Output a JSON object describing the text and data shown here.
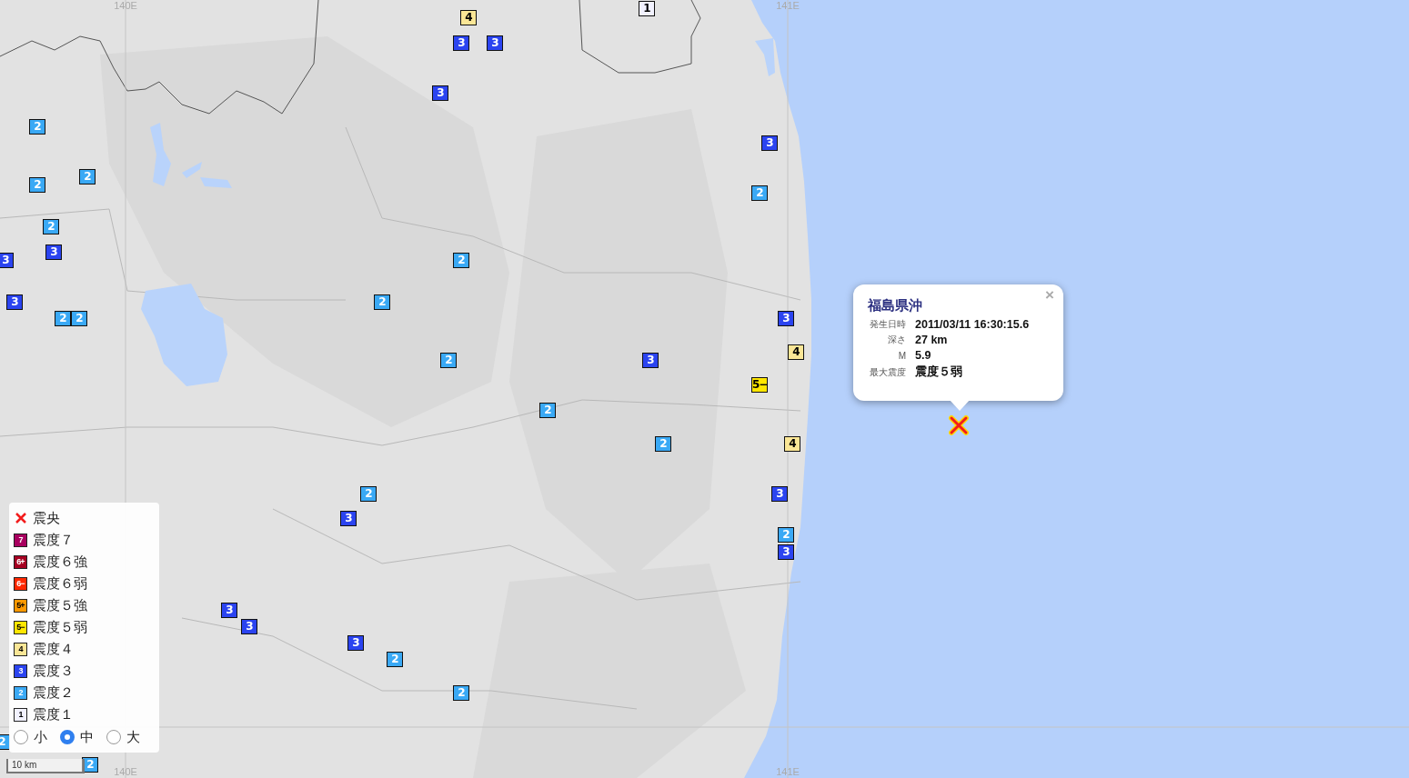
{
  "grid_labels": [
    "140E",
    "140E",
    "141E",
    "141E"
  ],
  "markers": [
    {
      "label": "1",
      "color": "#f2f2ff"
    },
    {
      "label": "4",
      "color": "#fae696"
    },
    {
      "label": "3",
      "color": "#2b44f0"
    },
    {
      "label": "3",
      "color": "#2b44f0"
    },
    {
      "label": "3",
      "color": "#2b44f0"
    },
    {
      "label": "2",
      "color": "#3aa9f5"
    },
    {
      "label": "2",
      "color": "#3aa9f5"
    },
    {
      "label": "2",
      "color": "#3aa9f5"
    },
    {
      "label": "2",
      "color": "#3aa9f5"
    },
    {
      "label": "3",
      "color": "#2b44f0"
    },
    {
      "label": "3",
      "color": "#2b44f0"
    },
    {
      "label": "3",
      "color": "#2b44f0"
    },
    {
      "label": "2",
      "color": "#3aa9f5"
    },
    {
      "label": "2",
      "color": "#3aa9f5"
    },
    {
      "label": "2",
      "color": "#3aa9f5"
    },
    {
      "label": "2",
      "color": "#3aa9f5"
    },
    {
      "label": "2",
      "color": "#3aa9f5"
    },
    {
      "label": "3",
      "color": "#2b44f0"
    },
    {
      "label": "2",
      "color": "#3aa9f5"
    },
    {
      "label": "2",
      "color": "#3aa9f5"
    },
    {
      "label": "3",
      "color": "#2b44f0"
    },
    {
      "label": "2",
      "color": "#3aa9f5"
    },
    {
      "label": "3",
      "color": "#2b44f0"
    },
    {
      "label": "4",
      "color": "#fae696"
    },
    {
      "label": "5−",
      "color": "#ffe600"
    },
    {
      "label": "4",
      "color": "#fae696"
    },
    {
      "label": "3",
      "color": "#2b44f0"
    },
    {
      "label": "2",
      "color": "#3aa9f5"
    },
    {
      "label": "3",
      "color": "#2b44f0"
    },
    {
      "label": "2",
      "color": "#3aa9f5"
    },
    {
      "label": "3",
      "color": "#2b44f0"
    },
    {
      "label": "3",
      "color": "#2b44f0"
    },
    {
      "label": "3",
      "color": "#2b44f0"
    },
    {
      "label": "3",
      "color": "#2b44f0"
    },
    {
      "label": "2",
      "color": "#3aa9f5"
    },
    {
      "label": "2",
      "color": "#3aa9f5"
    },
    {
      "label": "2",
      "color": "#3aa9f5"
    },
    {
      "label": "2",
      "color": "#3aa9f5"
    }
  ],
  "popup": {
    "title": "福島県沖",
    "rows": [
      {
        "label": "発生日時",
        "value": "2011/03/11 16:30:15.6"
      },
      {
        "label": "深さ",
        "value": "27 km"
      },
      {
        "label": "M",
        "value": "5.9"
      },
      {
        "label": "最大震度",
        "value": "震度５弱"
      }
    ],
    "close": "×"
  },
  "legend": {
    "items": [
      {
        "kind": "epicenter",
        "label": "震央"
      },
      {
        "kind": "intensity",
        "badge": "7",
        "color": "#a8005f",
        "label": "震度７"
      },
      {
        "kind": "intensity",
        "badge": "6+",
        "color": "#a50021",
        "label": "震度６強"
      },
      {
        "kind": "intensity",
        "badge": "6−",
        "color": "#ff2800",
        "label": "震度６弱"
      },
      {
        "kind": "intensity",
        "badge": "5+",
        "color": "#ff9900",
        "label": "震度５強"
      },
      {
        "kind": "intensity",
        "badge": "5−",
        "color": "#ffe600",
        "label": "震度５弱"
      },
      {
        "kind": "intensity",
        "badge": "4",
        "color": "#fae696",
        "label": "震度４"
      },
      {
        "kind": "intensity",
        "badge": "3",
        "color": "#2b44f0",
        "label": "震度３"
      },
      {
        "kind": "intensity",
        "badge": "2",
        "color": "#3aa9f5",
        "label": "震度２"
      },
      {
        "kind": "intensity",
        "badge": "1",
        "color": "#f2f2ff",
        "label": "震度１"
      }
    ],
    "sizes": [
      {
        "label": "小",
        "selected": false
      },
      {
        "label": "中",
        "selected": true
      },
      {
        "label": "大",
        "selected": false
      }
    ]
  },
  "scale": "10 km"
}
